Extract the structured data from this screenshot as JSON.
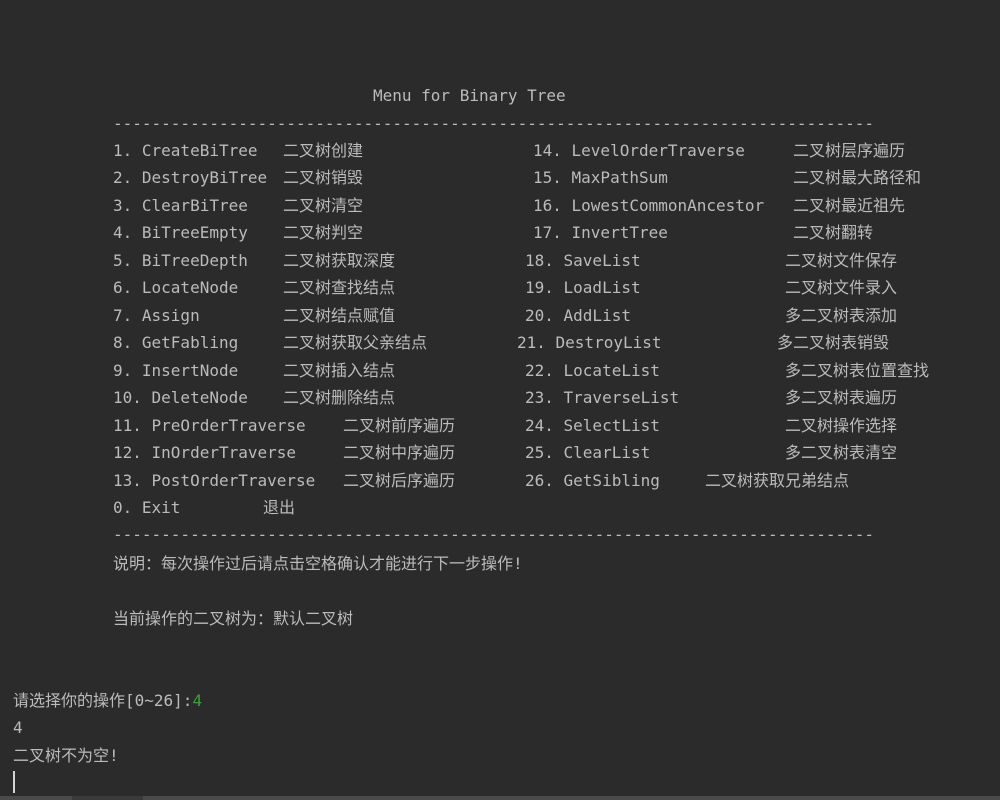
{
  "title": "Menu for Binary Tree",
  "divider": "---------------------------------------------------------------------------------",
  "menu_left": [
    {
      "cmd": "1. CreateBiTree",
      "desc": "二叉树创建"
    },
    {
      "cmd": "2. DestroyBiTree",
      "desc": "二叉树销毁"
    },
    {
      "cmd": "3. ClearBiTree",
      "desc": "二叉树清空"
    },
    {
      "cmd": "4. BiTreeEmpty",
      "desc": "二叉树判空"
    },
    {
      "cmd": "5. BiTreeDepth",
      "desc": "二叉树获取深度"
    },
    {
      "cmd": "6. LocateNode",
      "desc": "二叉树查找结点"
    },
    {
      "cmd": "7. Assign",
      "desc": "二叉树结点赋值"
    },
    {
      "cmd": "8. GetFabling",
      "desc": "二叉树获取父亲结点"
    },
    {
      "cmd": "9. InsertNode",
      "desc": "二叉树插入结点"
    },
    {
      "cmd": "10. DeleteNode",
      "desc": "二叉树删除结点"
    },
    {
      "cmd": "11. PreOrderTraverse",
      "desc": "二叉树前序遍历"
    },
    {
      "cmd": "12. InOrderTraverse",
      "desc": "二叉树中序遍历"
    },
    {
      "cmd": "13. PostOrderTraverse",
      "desc": "二叉树后序遍历"
    },
    {
      "cmd": "0. Exit",
      "desc": "退出"
    }
  ],
  "menu_right": [
    {
      "cmd": "14. LevelOrderTraverse",
      "desc": "二叉树层序遍历"
    },
    {
      "cmd": "15. MaxPathSum",
      "desc": "二叉树最大路径和"
    },
    {
      "cmd": "16. LowestCommonAncestor",
      "desc": "二叉树最近祖先"
    },
    {
      "cmd": "17. InvertTree",
      "desc": "二叉树翻转"
    },
    {
      "cmd": "18. SaveList",
      "desc": "二叉树文件保存"
    },
    {
      "cmd": "19. LoadList",
      "desc": "二叉树文件录入"
    },
    {
      "cmd": "20. AddList",
      "desc": "多二叉树表添加"
    },
    {
      "cmd": "21. DestroyList",
      "desc": "多二叉树表销毁"
    },
    {
      "cmd": "22. LocateList",
      "desc": "多二叉树表位置查找"
    },
    {
      "cmd": "23. TraverseList",
      "desc": "多二叉树表遍历"
    },
    {
      "cmd": "24. SelectList",
      "desc": "二叉树操作选择"
    },
    {
      "cmd": "25. ClearList",
      "desc": "多二叉树表清空"
    },
    {
      "cmd": "26. GetSibling",
      "desc": "二叉树获取兄弟结点"
    }
  ],
  "note": "说明：每次操作过后请点击空格确认才能进行下一步操作!",
  "current_tree": "当前操作的二叉树为：默认二叉树",
  "prompt": "请选择你的操作[0~26]:",
  "prompt_input": "4",
  "echo": "4",
  "result": "二叉树不为空!",
  "colors": {
    "background": "#2b2b2b",
    "text": "#bbbbbb",
    "input": "#3f9f3f"
  }
}
